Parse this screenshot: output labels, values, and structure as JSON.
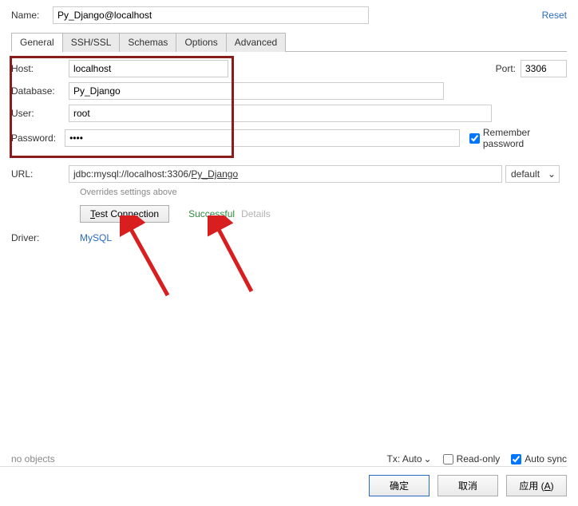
{
  "top": {
    "name_label": "Name:",
    "name_value": "Py_Django@localhost",
    "reset": "Reset"
  },
  "tabs": {
    "general": "General",
    "ssh": "SSH/SSL",
    "schemas": "Schemas",
    "options": "Options",
    "advanced": "Advanced"
  },
  "form": {
    "host_label": "Host:",
    "host_value": "localhost",
    "port_label": "Port:",
    "port_value": "3306",
    "db_label": "Database:",
    "db_value": "Py_Django",
    "user_label": "User:",
    "user_value": "root",
    "pwd_label": "Password:",
    "pwd_value": "••••",
    "remember_label": "Remember password",
    "url_label": "URL:",
    "url_prefix": "jdbc:mysql://localhost:3306/",
    "url_suffix": "Py_Django",
    "url_dropdown": "default",
    "override_note": "Overrides settings above",
    "test_label": "Test Connection",
    "success": "Successful",
    "details": "Details",
    "driver_label": "Driver:",
    "driver_value": "MySQL"
  },
  "status": {
    "no_objects": "no objects",
    "tx_label": "Tx: Auto",
    "readonly": "Read-only",
    "autosync": "Auto sync"
  },
  "buttons": {
    "ok": "确定",
    "cancel": "取消",
    "apply_prefix": "应用 (",
    "apply_key": "A",
    "apply_suffix": ")"
  }
}
